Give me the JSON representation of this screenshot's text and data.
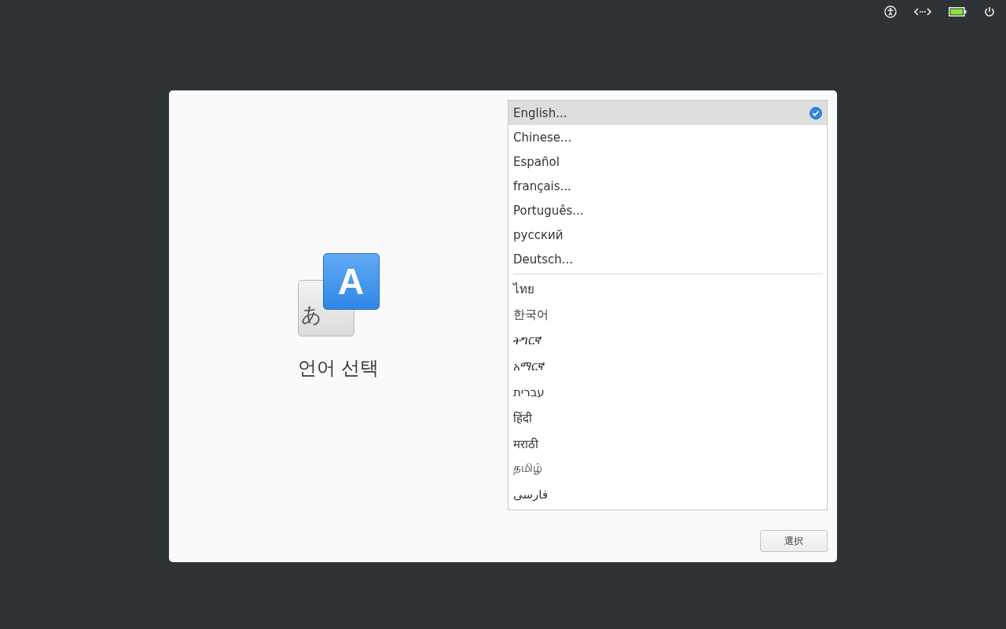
{
  "top_bar": {
    "battery": {
      "level": 1
    }
  },
  "dialog": {
    "icon_glyphs": [
      "あ",
      "A"
    ],
    "title": "언어 선택",
    "language_groups": [
      [
        {
          "label": "English...",
          "selected": true
        },
        {
          "label": "Chinese...",
          "selected": false
        },
        {
          "label": "Español",
          "selected": false
        },
        {
          "label": "français...",
          "selected": false
        },
        {
          "label": "Português...",
          "selected": false
        },
        {
          "label": "русский",
          "selected": false
        },
        {
          "label": "Deutsch...",
          "selected": false
        }
      ],
      [
        {
          "label": "ไทย",
          "selected": false
        },
        {
          "label": "한국어",
          "selected": false
        },
        {
          "label": "ትግርኛ",
          "selected": false
        },
        {
          "label": "አማርኛ",
          "selected": false
        },
        {
          "label": "עברית",
          "selected": false
        },
        {
          "label": "हिंदी",
          "selected": false
        },
        {
          "label": "मराठी",
          "selected": false
        },
        {
          "label": "தமிழ்",
          "selected": false
        },
        {
          "label": "فارسی",
          "selected": false
        }
      ]
    ],
    "button": "選択"
  }
}
